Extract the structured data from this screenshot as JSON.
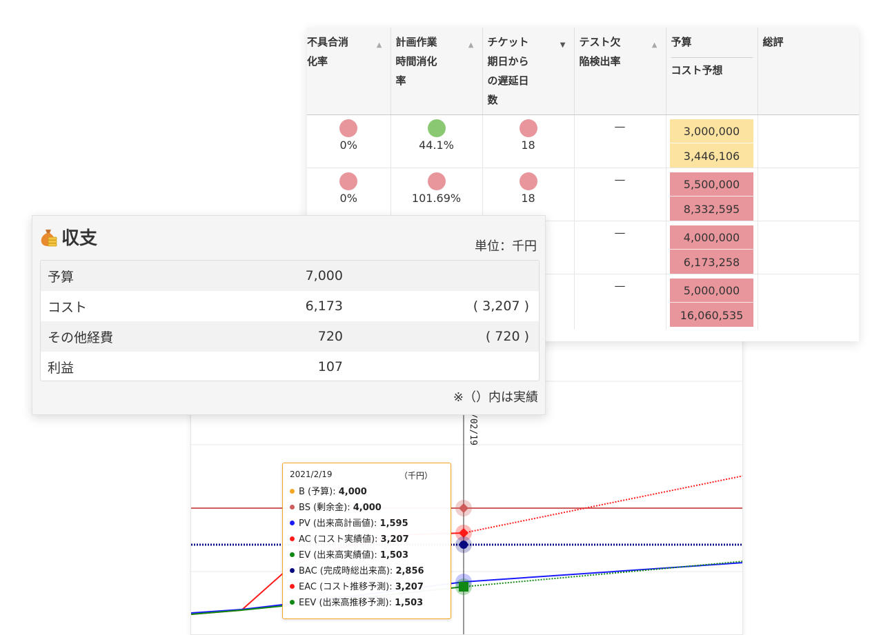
{
  "chart": {
    "crosshair_date_label": "/02/19",
    "tooltip": {
      "date": "2021/2/19",
      "unit": "（千円）",
      "rows": [
        {
          "label": "B (予算): ",
          "value": "4,000",
          "color": "#f5a623"
        },
        {
          "label": "BS (剰余金): ",
          "value": "4,000",
          "color": "#cd5c5c"
        },
        {
          "label": "PV (出来高計画値): ",
          "value": "1,595",
          "color": "#1a1aff"
        },
        {
          "label": "AC (コスト実績値): ",
          "value": "3,207",
          "color": "#ff1a1a"
        },
        {
          "label": "EV (出来高実績値): ",
          "value": "1,503",
          "color": "#118811"
        },
        {
          "label": "BAC (完成時総出来高): ",
          "value": "2,856",
          "color": "#0a0a80"
        },
        {
          "label": "EAC (コスト推移予測): ",
          "value": "3,207",
          "color": "#ff1a1a"
        },
        {
          "label": "EEV (出来高推移予測): ",
          "value": "1,503",
          "color": "#118811"
        }
      ]
    }
  },
  "table": {
    "headers": [
      {
        "label": "不具合消化率",
        "lines": [
          "不具合消",
          "化率"
        ],
        "sort": "asc"
      },
      {
        "label": "計画作業時間消化率",
        "lines": [
          "計画作業",
          "時間消化",
          "率"
        ],
        "sort": "asc"
      },
      {
        "label": "チケット期日からの遅延日数",
        "lines": [
          "チケット",
          "期日から",
          "の遅延日",
          "数"
        ],
        "sort": "desc"
      },
      {
        "label": "テスト欠陥検出率",
        "lines": [
          "テスト欠",
          "陥検出率"
        ],
        "sort": "asc"
      },
      {
        "label": "予算",
        "sub": "コスト予想"
      },
      {
        "label": "総評"
      }
    ],
    "rows": [
      {
        "defect_rate": "0%",
        "defect_status": "red",
        "work_rate": "44.1%",
        "work_status": "green",
        "delay": "18",
        "delay_status": "red",
        "test_rate": "—",
        "budget": "3,000,000",
        "cost_forecast": "3,446,106",
        "budget_status": "yellow"
      },
      {
        "defect_rate": "0%",
        "defect_status": "red",
        "work_rate": "101.69%",
        "work_status": "red",
        "delay": "18",
        "delay_status": "red",
        "test_rate": "—",
        "budget": "5,500,000",
        "cost_forecast": "8,332,595",
        "budget_status": "red"
      },
      {
        "defect_rate": "",
        "defect_status": "",
        "work_rate": "",
        "work_status": "",
        "delay": "",
        "delay_status": "",
        "test_rate": "—",
        "budget": "4,000,000",
        "cost_forecast": "6,173,258",
        "budget_status": "red"
      },
      {
        "defect_rate": "",
        "defect_status": "",
        "work_rate": "",
        "work_status": "",
        "delay": "",
        "delay_status": "",
        "test_rate": "—",
        "budget": "5,000,000",
        "cost_forecast": "16,060,535",
        "budget_status": "red"
      }
    ],
    "colors": {
      "red": "#e8969c",
      "green": "#8ac972",
      "yellow": "#fde3a0"
    }
  },
  "balance": {
    "title": "収支",
    "unit": "単位：千円",
    "rows": [
      {
        "label": "予算",
        "value": "7,000",
        "actual": ""
      },
      {
        "label": "コスト",
        "value": "6,173",
        "actual": "( 3,207 )"
      },
      {
        "label": "その他経費",
        "value": "720",
        "actual": "( 720 )"
      },
      {
        "label": "利益",
        "value": "107",
        "actual": ""
      }
    ],
    "note": "※（）内は実績"
  }
}
